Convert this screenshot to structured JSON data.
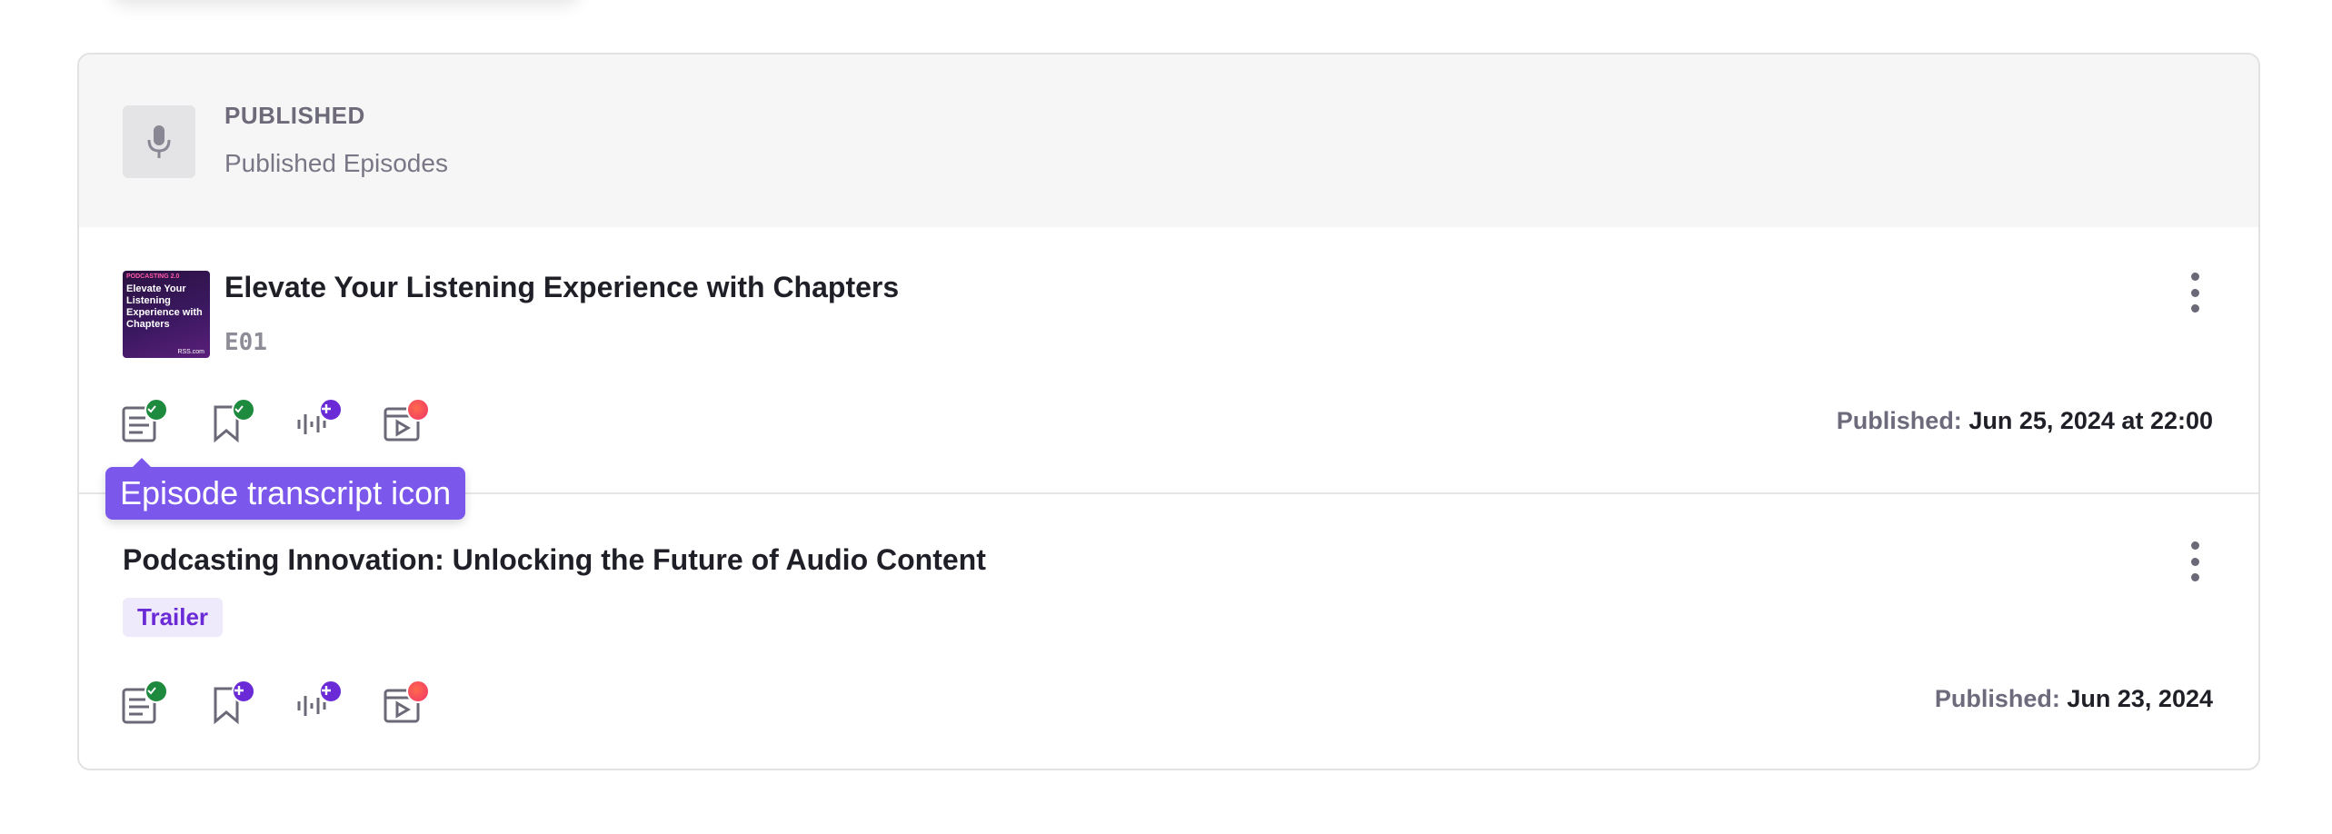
{
  "section": {
    "kicker": "PUBLISHED",
    "title": "Published Episodes"
  },
  "episodes": [
    {
      "title": "Elevate Your Listening Experience with Chapters",
      "number": "E01",
      "cover_text": "Elevate Your Listening Experience with Chapters",
      "cover_tag": "PODCASTING 2.0",
      "cover_brand": "RSS.com",
      "published_label": "Published:",
      "published_value": "Jun 25, 2024 at 22:00",
      "features": [
        {
          "icon": "transcript-icon",
          "status": "done"
        },
        {
          "icon": "chapters-icon",
          "status": "done"
        },
        {
          "icon": "soundbite-icon",
          "status": "add"
        },
        {
          "icon": "video-icon",
          "status": "new"
        }
      ]
    },
    {
      "title": "Podcasting Innovation: Unlocking the Future of Audio Content",
      "badge": "Trailer",
      "published_label": "Published:",
      "published_value": "Jun 23, 2024",
      "features": [
        {
          "icon": "transcript-icon",
          "status": "done"
        },
        {
          "icon": "chapters-icon",
          "status": "add"
        },
        {
          "icon": "soundbite-icon",
          "status": "add"
        },
        {
          "icon": "video-icon",
          "status": "new"
        }
      ]
    }
  ],
  "tooltip": {
    "text": "Episode transcript icon"
  },
  "colors": {
    "accent": "#6a2bd6",
    "tooltip_bg": "#7b57ec",
    "done_green": "#1e8a3e",
    "new_red": "#f0346a"
  }
}
